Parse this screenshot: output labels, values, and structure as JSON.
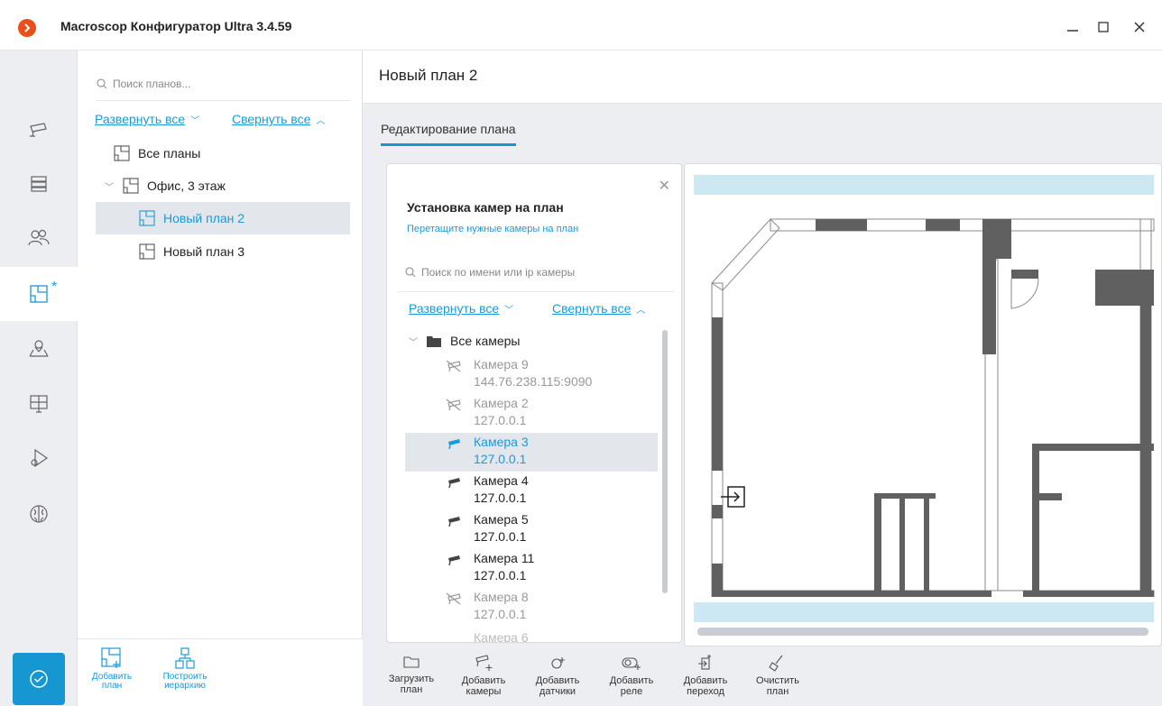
{
  "window": {
    "title": "Macroscop Конфигуратор Ultra 3.4.59",
    "minimize_glyph": "—",
    "maximize_glyph": "☐",
    "close_glyph": "✕"
  },
  "rail": {
    "items": [
      {
        "icon": "camera-icon"
      },
      {
        "icon": "server-icon"
      },
      {
        "icon": "users-icon"
      },
      {
        "icon": "plan-icon",
        "active": true,
        "badge": "*"
      },
      {
        "icon": "map-pin-icon"
      },
      {
        "icon": "monitor-layout-icon"
      },
      {
        "icon": "camera-settings-icon"
      },
      {
        "icon": "brain-icon"
      }
    ],
    "confirm_icon": "check-circle-icon"
  },
  "plans_panel": {
    "search_placeholder": "Поиск планов...",
    "expand_all": "Развернуть все",
    "collapse_all": "Свернуть все",
    "tree": [
      {
        "label": "Все планы",
        "level": 0
      },
      {
        "label": "Офис, 3 этаж",
        "level": 1,
        "expanded": true
      },
      {
        "label": "Новый план 2",
        "level": 2,
        "selected": true
      },
      {
        "label": "Новый план 3",
        "level": 2
      }
    ],
    "footer": {
      "add_plan": [
        "Добавить",
        "план"
      ],
      "build_hierarchy": [
        "Построить",
        "иерархию"
      ]
    }
  },
  "main": {
    "title": "Новый план 2",
    "tab": "Редактирование плана"
  },
  "camera_panel": {
    "title": "Установка камер на план",
    "subtitle": "Перетащите нужные камеры на план",
    "search_placeholder": "Поиск по имени или ip камеры",
    "expand_all": "Развернуть все",
    "collapse_all": "Свернуть все",
    "root": "Все камеры",
    "cameras": [
      {
        "name": "Камера 9",
        "addr": "144.76.238.115:9090",
        "placed": true
      },
      {
        "name": "Камера 2",
        "addr": "127.0.0.1",
        "placed": true
      },
      {
        "name": "Камера 3",
        "addr": "127.0.0.1",
        "selected": true
      },
      {
        "name": "Камера 4",
        "addr": "127.0.0.1"
      },
      {
        "name": "Камера 5",
        "addr": "127.0.0.1"
      },
      {
        "name": "Камера 11",
        "addr": "127.0.0.1"
      },
      {
        "name": "Камера 8",
        "addr": "127.0.0.1",
        "placed": true
      }
    ],
    "partial_item": "Камера 6"
  },
  "toolbar": [
    {
      "line1": "Загрузить",
      "line2": "план",
      "icon": "folder-icon"
    },
    {
      "line1": "Добавить",
      "line2": "камеры",
      "icon": "add-camera-icon"
    },
    {
      "line1": "Добавить",
      "line2": "датчики",
      "icon": "sensor-icon"
    },
    {
      "line1": "Добавить",
      "line2": "реле",
      "icon": "relay-icon"
    },
    {
      "line1": "Добавить",
      "line2": "переход",
      "icon": "transition-icon"
    },
    {
      "line1": "Очистить",
      "line2": "план",
      "icon": "clear-icon"
    }
  ],
  "colors": {
    "accent": "#1797d2",
    "link": "#1a9ad8",
    "logo": "#e94e1b",
    "wall": "#606060",
    "selected_bg": "#e3e6ea"
  }
}
